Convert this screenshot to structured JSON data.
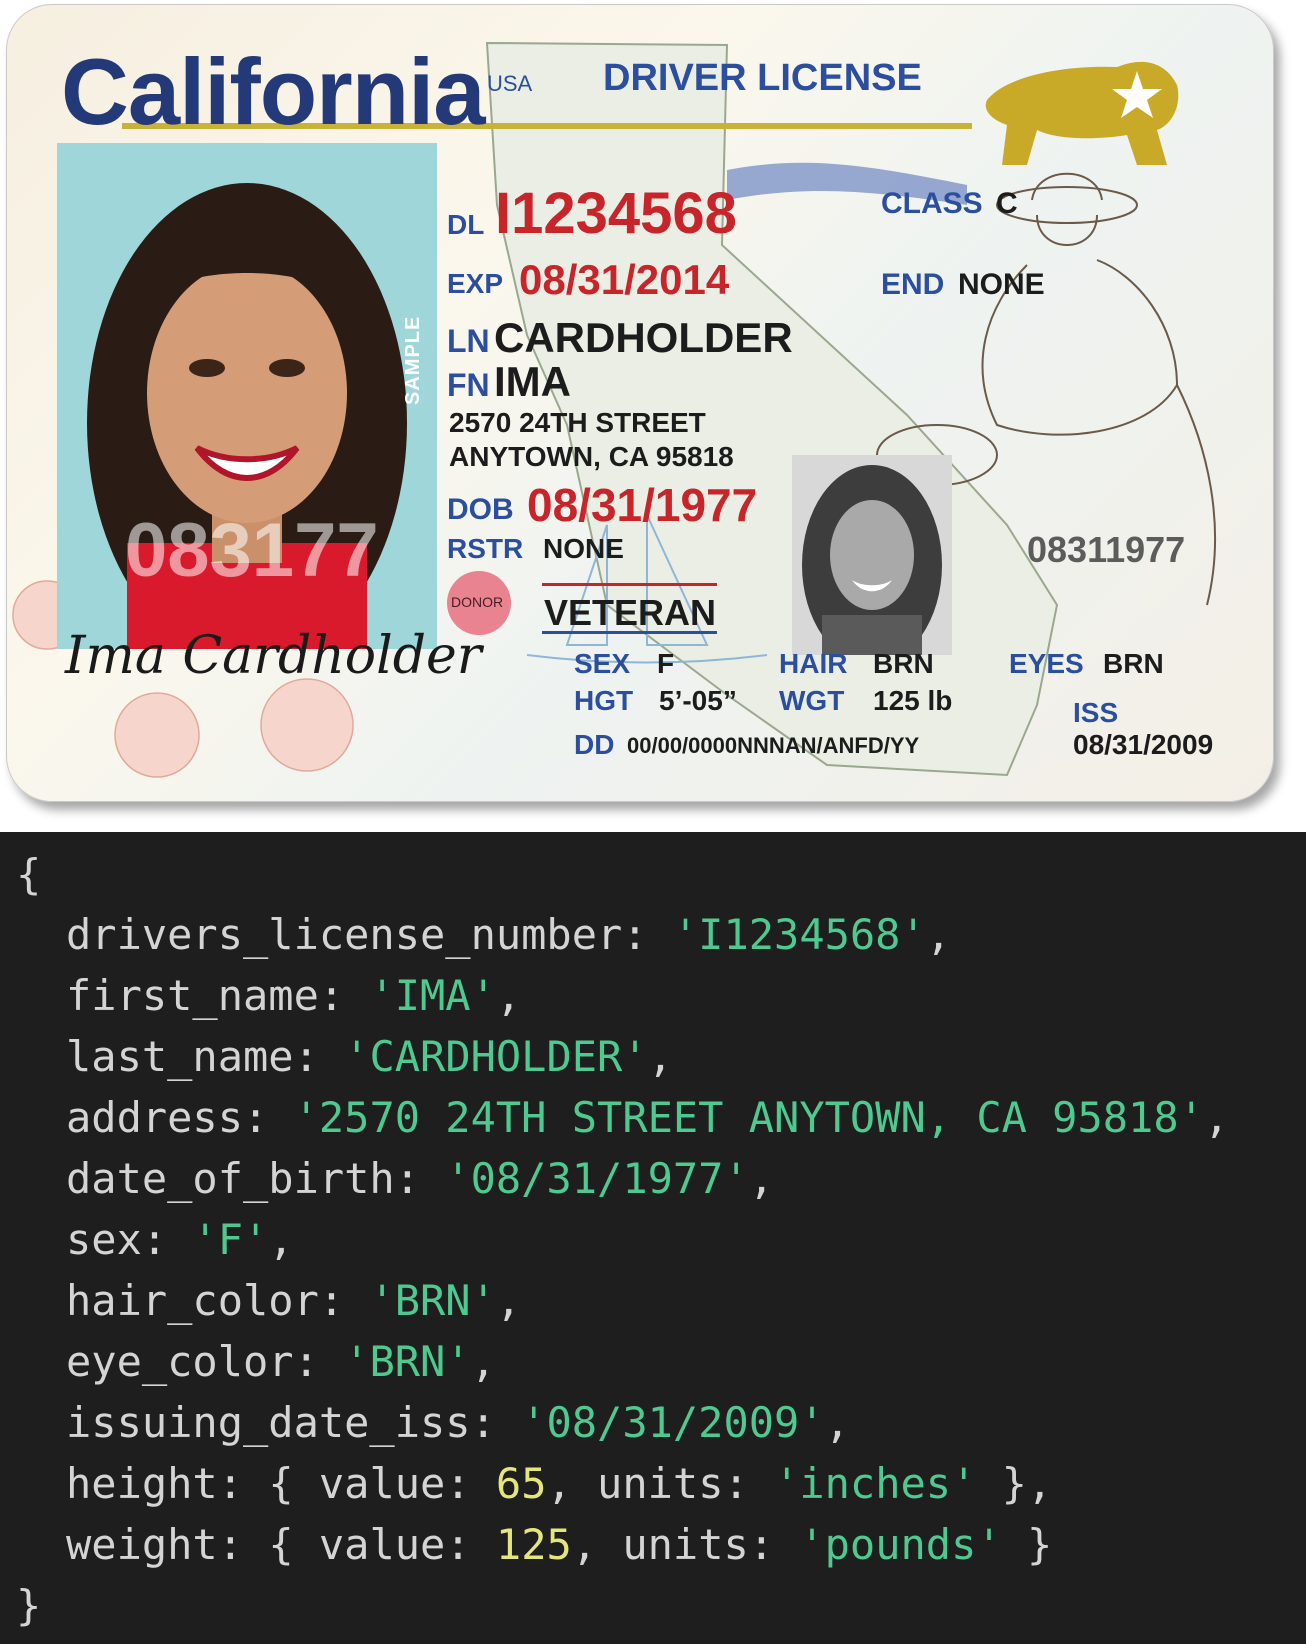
{
  "card": {
    "state": "California",
    "country": "USA",
    "title": "DRIVER LICENSE",
    "photo_watermark": "SAMPLE",
    "dl_label": "DL",
    "dl_number": "I1234568",
    "exp_label": "EXP",
    "exp_date": "08/31/2014",
    "ln_label": "LN",
    "last_name": "CARDHOLDER",
    "fn_label": "FN",
    "first_name": "IMA",
    "address_line1": "2570 24TH STREET",
    "address_line2": "ANYTOWN, CA 95818",
    "dob_label": "DOB",
    "dob": "08/31/1977",
    "rstr_label": "RSTR",
    "rstr": "NONE",
    "class_label": "CLASS",
    "class_value": "C",
    "end_label": "END",
    "end_value": "NONE",
    "donor": "DONOR",
    "veteran": "VETERAN",
    "sex_label": "SEX",
    "sex": "F",
    "hair_label": "HAIR",
    "hair": "BRN",
    "eyes_label": "EYES",
    "eyes": "BRN",
    "hgt_label": "HGT",
    "hgt": "5’-05”",
    "wgt_label": "WGT",
    "wgt": "125 lb",
    "iss_label": "ISS",
    "iss": "08/31/2009",
    "dd_label": "DD",
    "dd": "00/00/0000NNNAN/ANFD/YY",
    "ghost_dob": "08311977",
    "photo_number": "083177",
    "signature": "Ima Cardholder"
  },
  "code": {
    "open": "{",
    "close": "}",
    "lines": [
      {
        "key": "drivers_license_number:",
        "value": "'I1234568'",
        "tail": ","
      },
      {
        "key": "first_name:",
        "value": "'IMA'",
        "tail": ","
      },
      {
        "key": "last_name:",
        "value": "'CARDHOLDER'",
        "tail": ","
      },
      {
        "key": "address:",
        "value": "'2570 24TH STREET ANYTOWN, CA 95818'",
        "tail": ","
      },
      {
        "key": "date_of_birth:",
        "value": "'08/31/1977'",
        "tail": ","
      },
      {
        "key": "sex:",
        "value": "'F'",
        "tail": ","
      },
      {
        "key": "hair_color:",
        "value": "'BRN'",
        "tail": ","
      },
      {
        "key": "eye_color:",
        "value": "'BRN'",
        "tail": ","
      },
      {
        "key": "issuing_date_iss:",
        "value": "'08/31/2009'",
        "tail": ","
      }
    ],
    "height": {
      "key": "height:",
      "open": "{ value:",
      "num": "65",
      "mid": ", units:",
      "unit": "'inches'",
      "close": "},"
    },
    "weight": {
      "key": "weight:",
      "open": "{ value:",
      "num": "125",
      "mid": ", units:",
      "unit": "'pounds'",
      "close": "}"
    }
  }
}
